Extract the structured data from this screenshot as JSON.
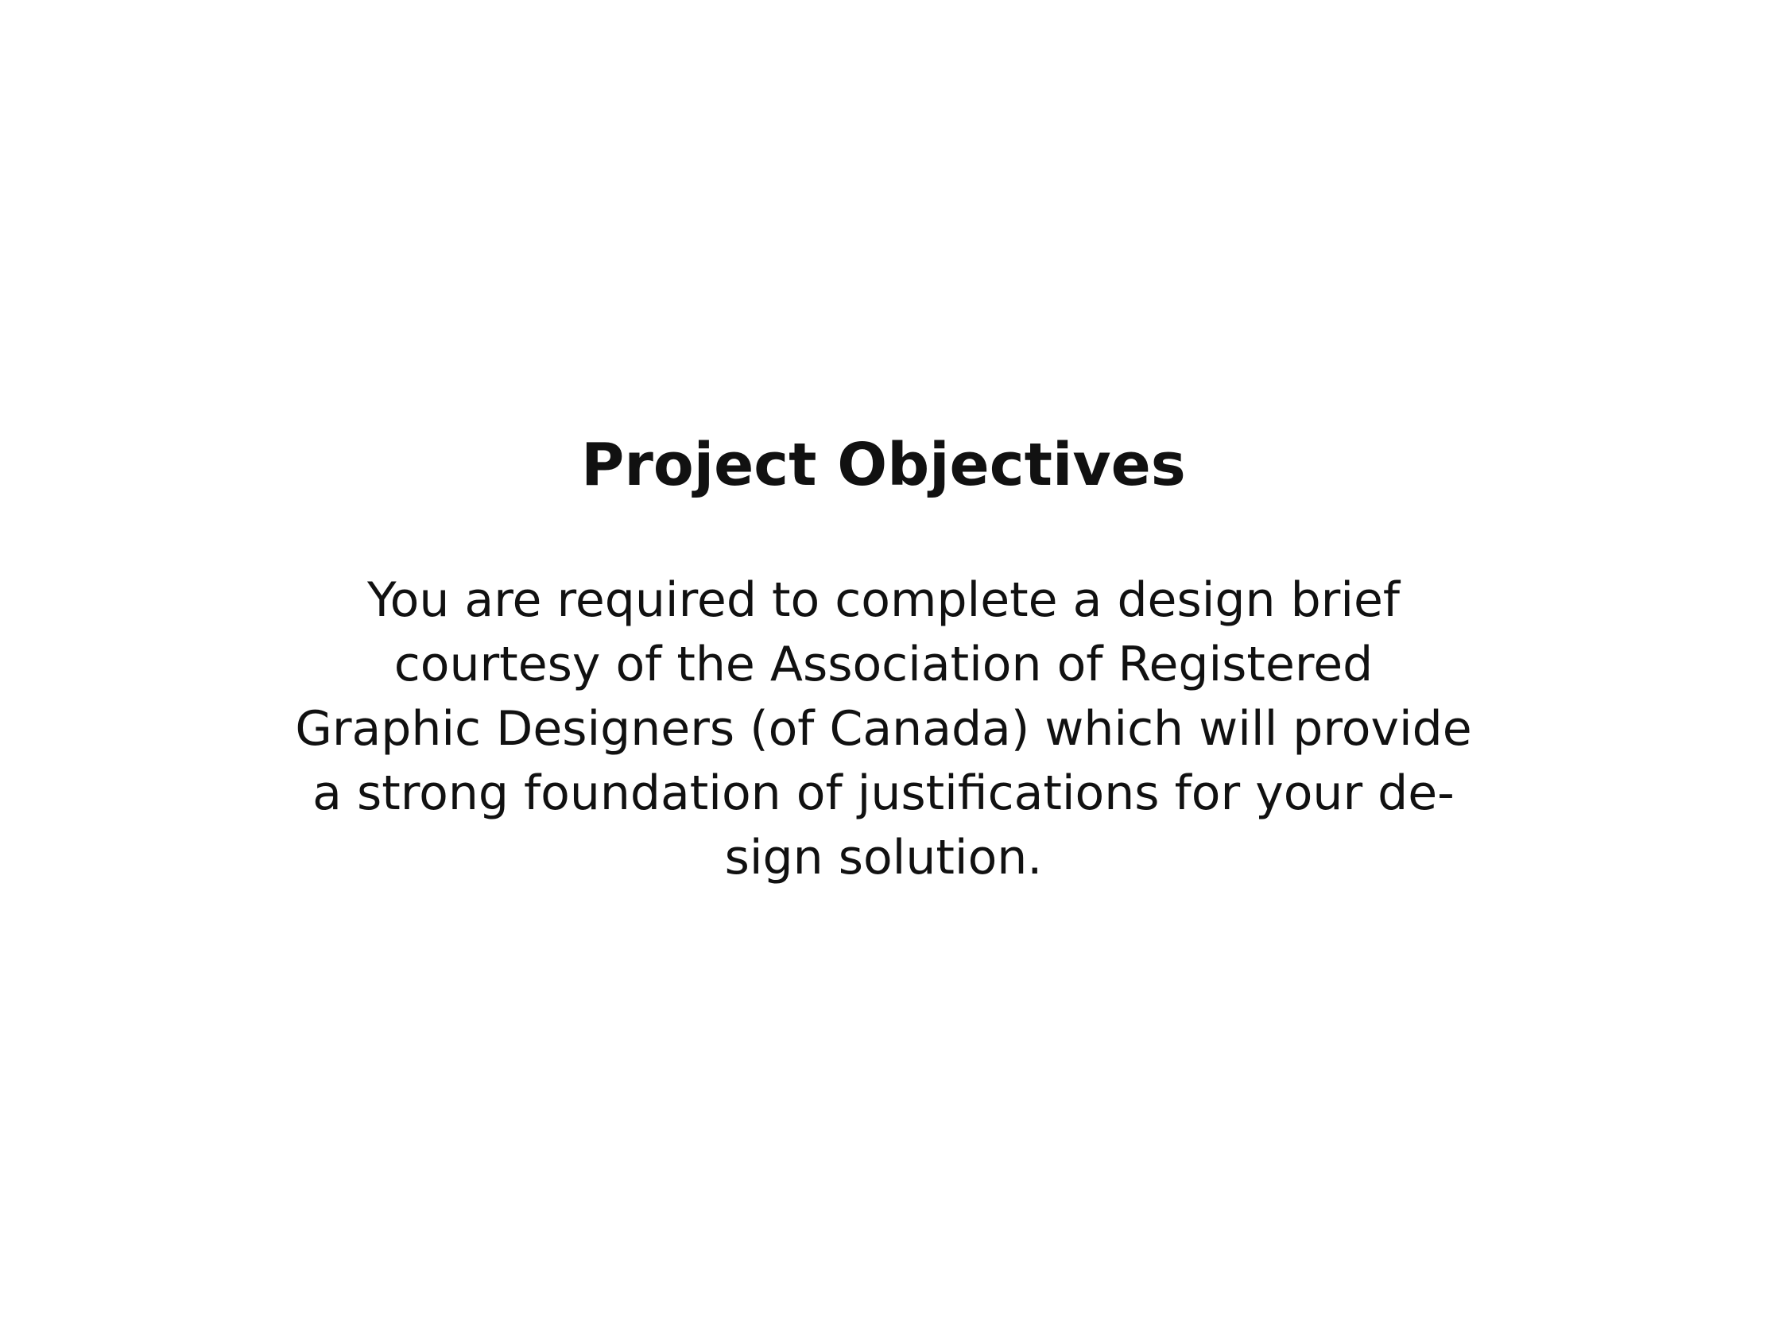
{
  "slide": {
    "title": "Project Objectives",
    "body_lines": [
      "You are required to complete a design brief",
      "courtesy of the Association of Registered",
      "Graphic Designers (of Canada) which will provide",
      "a strong foundation of justifications for your de-",
      "sign solution."
    ]
  }
}
